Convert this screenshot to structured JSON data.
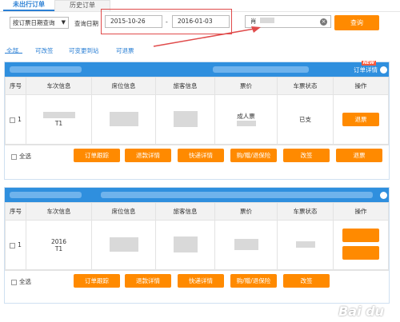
{
  "tabs": [
    {
      "label": "未出行订单",
      "active": true
    },
    {
      "label": "历史订单",
      "active": false
    }
  ],
  "search": {
    "query_type": "按订票日期查询",
    "date_label": "查询日期",
    "date_from": "2015-10-26",
    "date_sep": "-",
    "date_to": "2016-01-03",
    "name_value": "肖",
    "query_button": "查询"
  },
  "filters": [
    "全部",
    "可改签",
    "可变更到站",
    "可退票"
  ],
  "orders": [
    {
      "detail_link": "订单详情",
      "new_badge": "NEW",
      "columns": [
        "序号",
        "车次信息",
        "席位信息",
        "旅客信息",
        "票价",
        "车票状态",
        "操作"
      ],
      "row": {
        "index": "1",
        "train": "T1",
        "ticket_type": "成人票",
        "status": "已支",
        "action": "退票"
      },
      "select_all": "全选",
      "footer_buttons": [
        "订单跟踪",
        "退款详情",
        "快递详情",
        "购/赠/退保险",
        "改签",
        "退票"
      ]
    },
    {
      "columns": [
        "序号",
        "车次信息",
        "席位信息",
        "旅客信息",
        "票价",
        "车票状态",
        "操作"
      ],
      "row": {
        "index": "1",
        "train": "T1",
        "date": "2016"
      },
      "select_all": "全选",
      "footer_buttons": [
        "订单跟踪",
        "退款详情",
        "快递详情",
        "购/赠/退保险",
        "改签"
      ]
    }
  ],
  "colors": {
    "accent": "#2f8fde",
    "button": "#ff8a00",
    "highlight": "#e04b4b"
  }
}
